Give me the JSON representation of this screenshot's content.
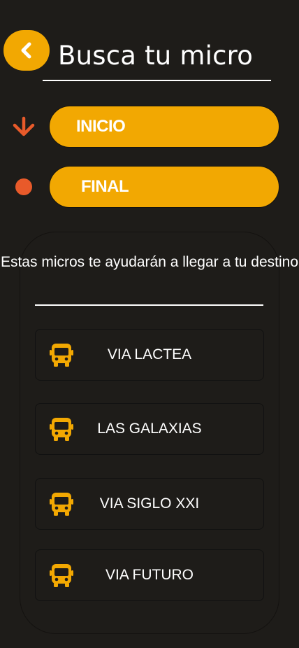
{
  "header": {
    "title": "Busca tu micro"
  },
  "inputs": {
    "inicio_label": "INICIO",
    "final_label": "FINAL"
  },
  "panel": {
    "message": "Estas micros te ayudarán a llegar a tu destino"
  },
  "routes": [
    {
      "label": "VIA LACTEA",
      "icon": "bus-icon"
    },
    {
      "label": "LAS GALAXIAS",
      "icon": "bus-icon"
    },
    {
      "label": "VIA SIGLO XXI",
      "icon": "bus-icon"
    },
    {
      "label": "VIA FUTURO",
      "icon": "bus-icon"
    }
  ],
  "colors": {
    "background": "#1e1c19",
    "accent": "#f2a802",
    "marker": "#e85a2a",
    "text": "#ffffff"
  }
}
